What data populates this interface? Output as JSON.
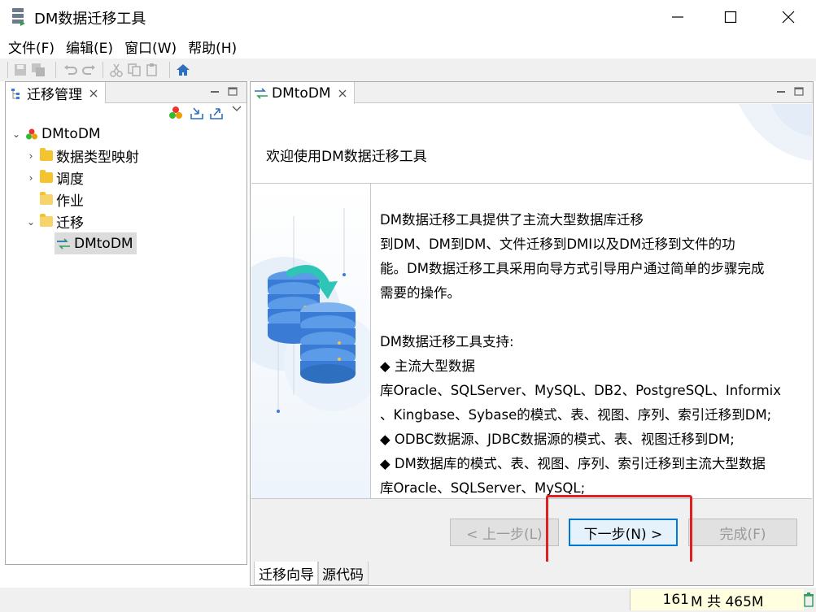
{
  "window": {
    "title": "DM数据迁移工具"
  },
  "menu": [
    "文件(F)",
    "编辑(E)",
    "窗口(W)",
    "帮助(H)"
  ],
  "left_panel": {
    "tab_label": "迁移管理",
    "tree": {
      "root": "DMtoDM",
      "items": [
        "数据类型映射",
        "调度",
        "作业",
        "迁移"
      ],
      "child": "DMtoDM"
    }
  },
  "right_panel": {
    "tab_label": "DMtoDM",
    "wizard": {
      "title": "欢迎使用DM数据迁移工具",
      "intro_lines": [
        "DM数据迁移工具提供了主流大型数据库迁移",
        "到DM、DM到DM、文件迁移到DMI以及DM迁移到文件的功",
        "能。DM数据迁移工具采用向导方式引导用户通过简单的步骤完成",
        "需要的操作。"
      ],
      "support_lines": [
        "DM数据迁移工具支持:",
        "◆ 主流大型数据",
        "库Oracle、SQLServer、MySQL、DB2、PostgreSQL、Informix",
        "、Kingbase、Sybase的模式、表、视图、序列、索引迁移到DM;",
        "◆ ODBC数据源、JDBC数据源的模式、表、视图迁移到DM;",
        "◆ DM数据库的模式、表、视图、序列、索引迁移到主流大型数据",
        "库Oracle、SQLServer、MySQL;"
      ],
      "buttons": {
        "back": "< 上一步(L)",
        "next": "下一步(N) >",
        "finish": "完成(F)"
      }
    },
    "bottom_tabs": [
      "迁移向导",
      "源代码"
    ]
  },
  "status": {
    "mem_used": "161",
    "mem_total": "M 共 465M"
  },
  "colors": {
    "accent": "#0078d7",
    "highlight": "#e02020",
    "db_blue": "#3a7bd5",
    "arrow": "#2ec4b6"
  }
}
